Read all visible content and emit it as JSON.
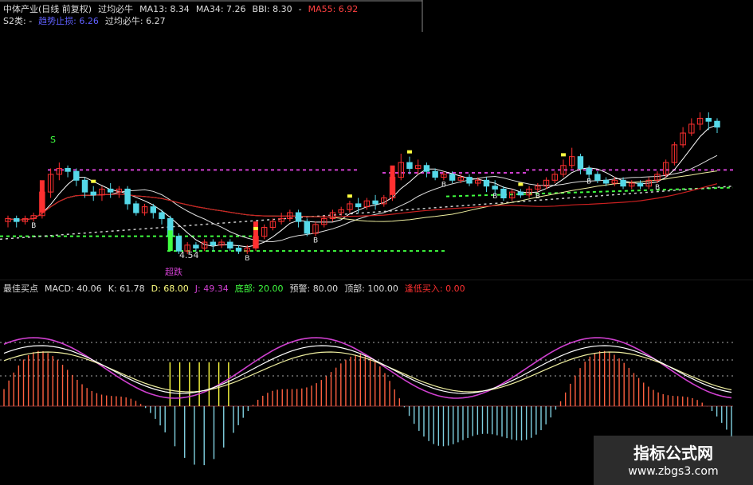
{
  "header": {
    "stock_name": "中体产业(日线 前复权)",
    "indicator": "过均必牛",
    "ma13_label": "MA13:",
    "ma13_value": "8.34",
    "ma34_label": "MA34:",
    "ma34_value": "7.26",
    "bbi_label": "BBI:",
    "bbi_value": "8.30",
    "dash": "-",
    "ma55_label": "MA55:",
    "ma55_value": "6.92"
  },
  "header2": {
    "s2_label": "S2类:",
    "s2_value": "-",
    "ma_label": "趋势止损:",
    "ma_value": "6.26",
    "gj_label": "过均必牛:",
    "gj_value": "6.27"
  },
  "annotations": {
    "low_price": "4.54",
    "chao_die": "超跌",
    "s_marker": "S",
    "b_marker": "B"
  },
  "sub_header": {
    "name": "最佳买点",
    "macd_label": "MACD:",
    "macd_value": "40.06",
    "k_label": "K:",
    "k_value": "61.78",
    "d_label": "D:",
    "d_value": "68.00",
    "j_label": "J:",
    "j_value": "49.34",
    "bottom_label": "底部:",
    "bottom_value": "20.00",
    "warn_label": "预警:",
    "warn_value": "80.00",
    "top_label": "顶部:",
    "top_value": "100.00",
    "buy_label": "逢低买入:",
    "buy_value": "0.00"
  },
  "watermark": {
    "title": "指标公式网",
    "url": "www.zbgs3.com"
  },
  "colors": {
    "up": "#ff3030",
    "down": "#55d8e8",
    "magenta": "#d040d0",
    "green": "#40ff40",
    "yellow": "#ffff40",
    "white": "#e8e8e8",
    "orange": "#ff8040"
  },
  "candles": [
    [
      5.6,
      5.7,
      5.5,
      5.8,
      5.4
    ],
    [
      5.7,
      5.6,
      5.5,
      5.8,
      5.4
    ],
    [
      5.6,
      5.7,
      5.5,
      5.8,
      5.5
    ],
    [
      5.7,
      5.8,
      5.6,
      5.9,
      5.6
    ],
    [
      5.8,
      6.6,
      5.8,
      6.7,
      5.7
    ],
    [
      6.6,
      7.2,
      6.5,
      7.4,
      6.4
    ],
    [
      7.2,
      7.4,
      7.1,
      7.6,
      7.0
    ],
    [
      7.4,
      7.3,
      7.2,
      7.5,
      7.1
    ],
    [
      7.3,
      7.0,
      6.9,
      7.4,
      6.8
    ],
    [
      7.0,
      6.6,
      6.5,
      7.1,
      6.4
    ],
    [
      6.6,
      6.5,
      6.4,
      6.8,
      6.3
    ],
    [
      6.5,
      6.7,
      6.4,
      6.8,
      6.3
    ],
    [
      6.7,
      6.6,
      6.5,
      6.9,
      6.4
    ],
    [
      6.6,
      6.7,
      6.5,
      6.8,
      6.4
    ],
    [
      6.7,
      6.2,
      6.1,
      6.8,
      6.0
    ],
    [
      6.2,
      5.9,
      5.8,
      6.3,
      5.8
    ],
    [
      5.9,
      6.1,
      5.9,
      6.2,
      5.8
    ],
    [
      6.1,
      5.9,
      5.8,
      6.2,
      5.7
    ],
    [
      5.9,
      5.7,
      5.6,
      6.0,
      5.5
    ],
    [
      5.7,
      5.1,
      5.0,
      5.8,
      4.9
    ],
    [
      5.1,
      4.6,
      4.6,
      5.2,
      4.5
    ],
    [
      4.6,
      4.8,
      4.6,
      4.9,
      4.5
    ],
    [
      4.8,
      4.7,
      4.6,
      4.9,
      4.6
    ],
    [
      4.7,
      4.9,
      4.6,
      5.0,
      4.6
    ],
    [
      4.9,
      4.8,
      4.7,
      5.0,
      4.6
    ],
    [
      4.8,
      4.9,
      4.7,
      5.0,
      4.7
    ],
    [
      4.9,
      4.7,
      4.6,
      5.0,
      4.6
    ],
    [
      4.7,
      4.6,
      4.5,
      4.8,
      4.5
    ],
    [
      4.6,
      4.7,
      4.5,
      4.8,
      4.5
    ],
    [
      4.7,
      5.1,
      4.6,
      5.2,
      4.6
    ],
    [
      5.1,
      5.4,
      5.0,
      5.5,
      5.0
    ],
    [
      5.4,
      5.6,
      5.3,
      5.7,
      5.3
    ],
    [
      5.6,
      5.7,
      5.5,
      5.9,
      5.5
    ],
    [
      5.7,
      5.9,
      5.6,
      6.0,
      5.6
    ],
    [
      5.9,
      5.6,
      5.4,
      6.0,
      5.4
    ],
    [
      5.6,
      5.2,
      5.1,
      5.7,
      5.1
    ],
    [
      5.2,
      5.5,
      5.1,
      5.6,
      5.1
    ],
    [
      5.5,
      5.7,
      5.4,
      5.8,
      5.4
    ],
    [
      5.7,
      5.9,
      5.6,
      6.0,
      5.6
    ],
    [
      5.9,
      6.0,
      5.8,
      6.1,
      5.8
    ],
    [
      6.0,
      6.2,
      5.9,
      6.3,
      5.9
    ],
    [
      6.2,
      6.1,
      6.0,
      6.4,
      5.9
    ],
    [
      6.1,
      6.3,
      6.0,
      6.4,
      6.0
    ],
    [
      6.3,
      6.2,
      6.1,
      6.5,
      6.0
    ],
    [
      6.2,
      6.4,
      6.1,
      6.5,
      6.1
    ],
    [
      6.4,
      7.1,
      6.3,
      7.2,
      6.3
    ],
    [
      7.1,
      7.6,
      7.0,
      7.9,
      7.0
    ],
    [
      7.6,
      7.4,
      7.3,
      7.8,
      7.2
    ],
    [
      7.4,
      7.5,
      7.3,
      7.7,
      7.2
    ],
    [
      7.5,
      7.3,
      7.2,
      7.6,
      7.1
    ],
    [
      7.3,
      7.1,
      7.0,
      7.4,
      7.0
    ],
    [
      7.1,
      7.2,
      7.0,
      7.3,
      7.0
    ],
    [
      7.2,
      7.0,
      6.9,
      7.3,
      6.9
    ],
    [
      7.0,
      7.1,
      6.9,
      7.2,
      6.9
    ],
    [
      7.1,
      6.9,
      6.8,
      7.2,
      6.8
    ],
    [
      6.9,
      7.0,
      6.8,
      7.1,
      6.8
    ],
    [
      7.0,
      6.8,
      6.7,
      7.1,
      6.6
    ],
    [
      6.8,
      6.7,
      6.6,
      7.0,
      6.5
    ],
    [
      6.7,
      6.4,
      6.3,
      6.8,
      6.3
    ],
    [
      6.4,
      6.6,
      6.3,
      6.7,
      6.3
    ],
    [
      6.6,
      6.5,
      6.4,
      6.7,
      6.4
    ],
    [
      6.5,
      6.7,
      6.4,
      6.8,
      6.4
    ],
    [
      6.7,
      6.8,
      6.6,
      6.9,
      6.6
    ],
    [
      6.8,
      7.0,
      6.7,
      7.1,
      6.7
    ],
    [
      7.0,
      7.2,
      6.9,
      7.3,
      6.9
    ],
    [
      7.2,
      7.5,
      7.1,
      7.7,
      7.1
    ],
    [
      7.5,
      7.8,
      7.4,
      8.1,
      7.4
    ],
    [
      7.8,
      7.4,
      7.3,
      7.9,
      7.2
    ],
    [
      7.4,
      7.2,
      7.1,
      7.5,
      7.0
    ],
    [
      7.2,
      7.0,
      6.9,
      7.3,
      6.9
    ],
    [
      7.0,
      6.9,
      6.8,
      7.1,
      6.8
    ],
    [
      6.9,
      7.0,
      6.8,
      7.1,
      6.8
    ],
    [
      7.0,
      6.8,
      6.7,
      7.1,
      6.7
    ],
    [
      6.8,
      6.9,
      6.7,
      7.0,
      6.7
    ],
    [
      6.9,
      6.8,
      6.7,
      7.0,
      6.7
    ],
    [
      6.8,
      7.0,
      6.7,
      7.1,
      6.7
    ],
    [
      7.0,
      7.2,
      6.9,
      7.3,
      6.9
    ],
    [
      7.2,
      7.6,
      7.1,
      7.7,
      7.1
    ],
    [
      7.6,
      8.2,
      7.5,
      8.3,
      7.5
    ],
    [
      8.2,
      8.6,
      8.1,
      8.8,
      8.1
    ],
    [
      8.6,
      8.9,
      8.5,
      9.1,
      8.5
    ],
    [
      8.9,
      9.1,
      8.8,
      9.3,
      8.7
    ],
    [
      9.1,
      9.0,
      8.8,
      9.3,
      8.7
    ],
    [
      9.0,
      8.8,
      8.7,
      9.1,
      8.6
    ]
  ]
}
